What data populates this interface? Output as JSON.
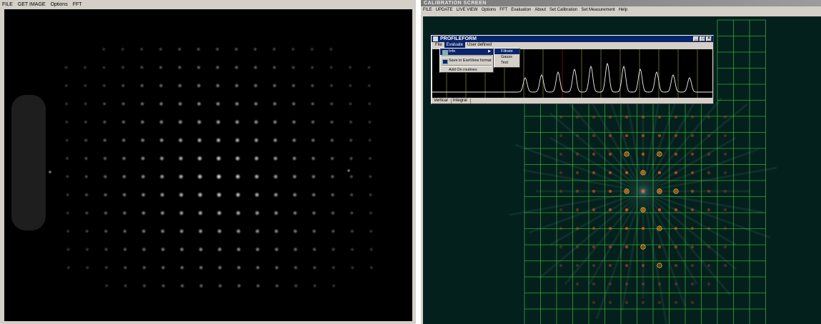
{
  "left_window": {
    "menu": [
      "FILE",
      "GET IMAGE",
      "Options",
      "FFT"
    ],
    "spot_grid": {
      "rows": 14,
      "cols": 17
    }
  },
  "right_window": {
    "title": "CALIBRATION SCREEN",
    "menu": [
      "FILE",
      "UPDATE",
      "LIVE VIEW",
      "Options",
      "FFT",
      "Evaluation",
      "About",
      "Set Calibration",
      "Set Measurement",
      "Help"
    ],
    "grid_color": "#3bbf3b",
    "spot_color": "#ff5a1e",
    "profile_form": {
      "title": "PROFILEFORM",
      "menu": [
        "File",
        "Evaluate",
        "User defined"
      ],
      "active_menu": "Evaluate",
      "dropdown": {
        "items": [
          "Info",
          "Save in ExelView format",
          "Add On routines"
        ],
        "selected": "Info"
      },
      "submenu": {
        "items": [
          "Filtrate",
          "Gauss",
          "Test"
        ],
        "selected": "Filtrate"
      },
      "status": [
        "Vertical",
        "Integral"
      ],
      "peak_count": 11
    }
  }
}
